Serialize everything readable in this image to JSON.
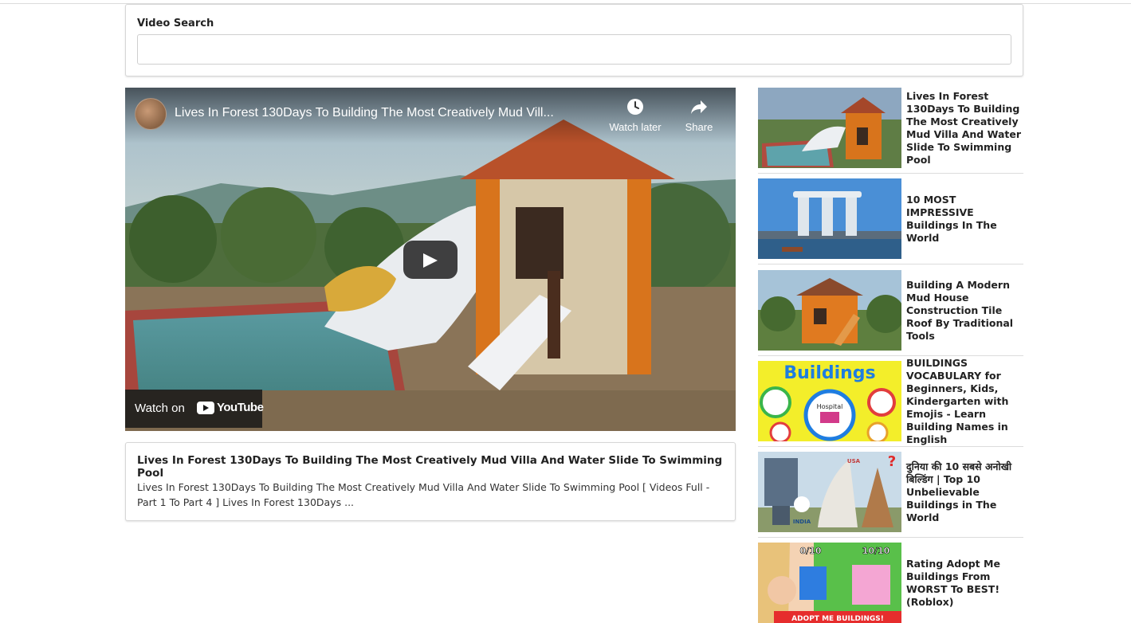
{
  "search": {
    "label": "Video Search",
    "value": "",
    "placeholder": ""
  },
  "player": {
    "title": "Lives In Forest 130Days To Building The Most Creatively Mud Vill...",
    "watch_later_label": "Watch later",
    "share_label": "Share",
    "watch_on_label": "Watch on",
    "youtube_label": "YouTube"
  },
  "selected_video": {
    "title": "Lives In Forest 130Days To Building The Most Creatively Mud Villa And Water Slide To Swimming Pool",
    "description": "Lives In Forest 130Days To Building The Most Creatively Mud Villa And Water Slide To Swimming Pool [ Videos Full - Part 1 To Part 4 ] Lives In Forest 130Days ..."
  },
  "related": [
    {
      "title": "Lives In Forest 130Days To Building The Most Creatively Mud Villa And Water Slide To Swimming Pool"
    },
    {
      "title": "10 MOST IMPRESSIVE Buildings In The World"
    },
    {
      "title": "Building A Modern Mud House Construction Tile Roof By Traditional Tools"
    },
    {
      "title": "BUILDINGS VOCABULARY for Beginners, Kids, Kindergarten with Emojis - Learn Building Names in English"
    },
    {
      "title": "दुनिया की 10 सबसे अनोखी बिल्डिंग | Top 10 Unbelievable Buildings in The World"
    },
    {
      "title": "Rating Adopt Me Buildings From WORST To BEST! (Roblox)"
    }
  ],
  "thumb_text": {
    "t4_word": "Buildings",
    "t4_hospital": "Hospital",
    "t5_usa": "USA",
    "t5_india": "INDIA",
    "t6_left": "0/10",
    "t6_right": "10/10",
    "t6_banner": "ADOPT ME BUILDINGS!"
  }
}
